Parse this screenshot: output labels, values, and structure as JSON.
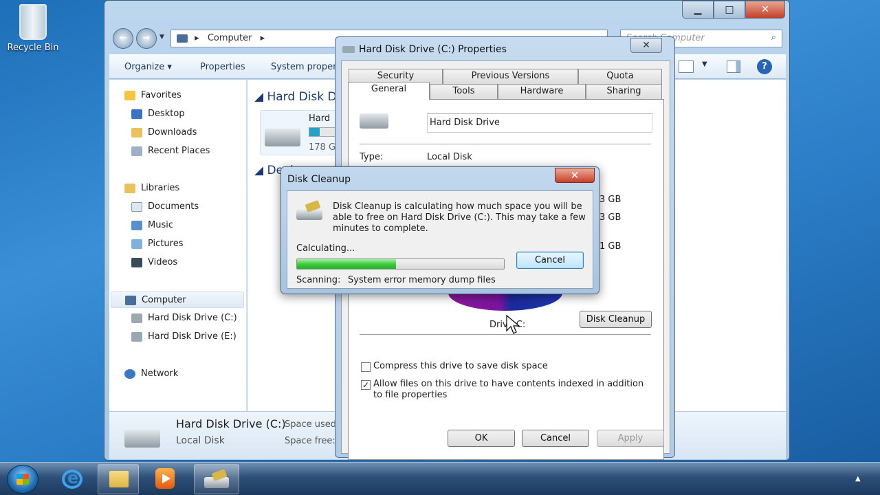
{
  "desktop": {
    "recycle_bin_label": "Recycle Bin"
  },
  "explorer": {
    "address": {
      "computer": "Computer"
    },
    "search_placeholder": "Search Computer",
    "toolbar": {
      "organize": "Organize",
      "properties": "Properties",
      "system_properties": "System proper"
    },
    "nav": {
      "favorites": "Favorites",
      "desktop": "Desktop",
      "downloads": "Downloads",
      "recent_places": "Recent Places",
      "libraries": "Libraries",
      "documents": "Documents",
      "music": "Music",
      "pictures": "Pictures",
      "videos": "Videos",
      "computer": "Computer",
      "drive_c": "Hard Disk Drive (C:)",
      "drive_e": "Hard Disk Drive (E:)",
      "network": "Network"
    },
    "content": {
      "group_hdd": "Hard Disk Dr",
      "drive_name": "Hard",
      "drive_free": "178 G",
      "group_devices": "Devic",
      "drive_fill_fraction": 0.35
    },
    "details": {
      "name": "Hard Disk Drive (C:)",
      "type": "Local Disk",
      "space_used_label": "Space used:",
      "space_free_label": "Space free:"
    }
  },
  "properties": {
    "title": "Hard Disk Drive (C:) Properties",
    "tabs_back": [
      "Security",
      "Previous Versions",
      "Quota"
    ],
    "tabs_front": [
      "General",
      "Tools",
      "Hardware",
      "Sharing"
    ],
    "drive_label": "Hard Disk Drive",
    "type_label": "Type:",
    "type_value": "Local Disk",
    "partial_values": [
      "3 GB",
      "3 GB",
      "1 GB"
    ],
    "drive_caption": "Drive C:",
    "disk_cleanup_button": "Disk Cleanup",
    "compress_label": "Compress this drive to save disk space",
    "compress_checked": false,
    "index_label": "Allow files on this drive to have contents indexed in addition to file properties",
    "index_checked": true,
    "ok": "OK",
    "cancel": "Cancel",
    "apply": "Apply"
  },
  "cleanup": {
    "title": "Disk Cleanup",
    "message": "Disk Cleanup is calculating how much space you will be able to free on Hard Disk Drive (C:). This may take a few minutes to complete.",
    "status": "Calculating...",
    "progress_fraction": 0.48,
    "cancel": "Cancel",
    "scanning_label": "Scanning:",
    "scanning_value": "System error memory dump files"
  },
  "colors": {
    "progress_green": "#3fcd3f",
    "accent_blue": "#1e6cb4"
  }
}
